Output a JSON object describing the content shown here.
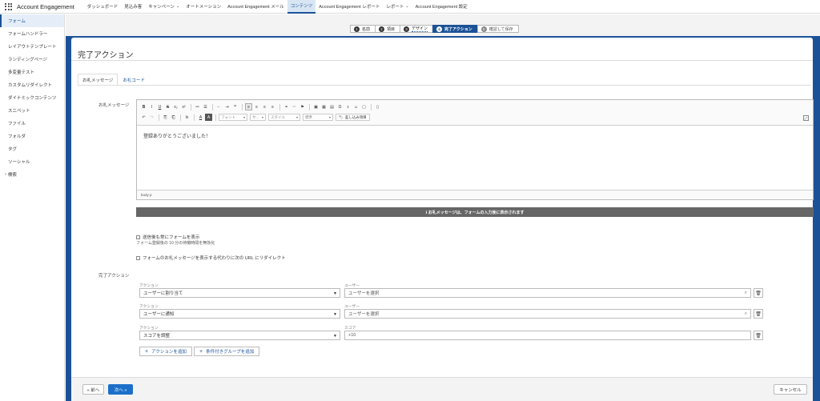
{
  "app": {
    "name": "Account Engagement"
  },
  "nav": {
    "items": [
      {
        "label": "ダッシュボード",
        "caret": false,
        "active": false
      },
      {
        "label": "見込み客",
        "caret": false,
        "active": false
      },
      {
        "label": "キャンペーン",
        "caret": true,
        "active": false
      },
      {
        "label": "オートメーション",
        "caret": false,
        "active": false
      },
      {
        "label": "Account Engagement メール",
        "caret": false,
        "active": false
      },
      {
        "label": "コンテンツ",
        "caret": false,
        "active": true
      },
      {
        "label": "Account Engagement レポート",
        "caret": false,
        "active": false
      },
      {
        "label": "レポート",
        "caret": true,
        "active": false
      },
      {
        "label": "Account Engagement 設定",
        "caret": false,
        "active": false
      }
    ]
  },
  "sidebar": {
    "items": [
      {
        "label": "フォーム",
        "active": true
      },
      {
        "label": "フォームハンドラー"
      },
      {
        "label": "レイアウトテンプレート"
      },
      {
        "label": "ランディングページ"
      },
      {
        "label": "多変量テスト"
      },
      {
        "label": "カスタムリダイレクト"
      },
      {
        "label": "ダイナミックコンテンツ"
      },
      {
        "label": "スニペット"
      },
      {
        "label": "ファイル"
      },
      {
        "label": "フォルダ"
      },
      {
        "label": "タグ"
      },
      {
        "label": "ソーシャル"
      },
      {
        "label": "検索",
        "chevron": true
      }
    ]
  },
  "steps": [
    {
      "num": "1",
      "label": "名前",
      "state": "done"
    },
    {
      "num": "2",
      "label": "項目",
      "state": "done"
    },
    {
      "num": "3",
      "label": "デザイン",
      "state": "done"
    },
    {
      "num": "4",
      "label": "完了アクション",
      "state": "current"
    },
    {
      "num": "5",
      "label": "確認して保存",
      "state": "future"
    }
  ],
  "page": {
    "title": "完了アクション"
  },
  "tabs": {
    "thanks_message": "お礼メッセージ",
    "thanks_code": "お礼コード"
  },
  "form": {
    "thanks_label": "お礼メッセージ",
    "editor": {
      "font_label": "フォント",
      "size_label": "サ...",
      "style_label": "スタイル",
      "format_label": "標準",
      "insert_merge": "差し込み項目",
      "body_text": "登録ありがとうございました！",
      "status_path": "body  p"
    },
    "info_bar": "ℹ お礼メッセージは、フォームの入力後に表示されます",
    "show_form_again": "送信後も常にフォームを表示",
    "show_form_note": "フォーム登録後の 10 分の待機時間を無効化",
    "redirect_label": "フォームのお礼メッセージを表示する代わりに次の URL にリダイレクト"
  },
  "completion": {
    "section_label": "完了アクション",
    "rows": [
      {
        "action_label": "アクション",
        "action_value": "ユーザーに割り当て",
        "target_label": "ユーザー",
        "target_value": "ユーザーを選択",
        "search": true
      },
      {
        "action_label": "アクション",
        "action_value": "ユーザーに通知",
        "target_label": "ユーザー",
        "target_value": "ユーザーを選択",
        "search": true
      },
      {
        "action_label": "アクション",
        "action_value": "スコアを調整",
        "target_label": "スコア",
        "target_value": "+10",
        "search": false
      }
    ],
    "add_action": "アクションを追加",
    "add_conditional_group": "条件付きグループを追加"
  },
  "footer": {
    "back": "« 前へ",
    "next": "次へ »",
    "cancel": "キャンセル"
  }
}
